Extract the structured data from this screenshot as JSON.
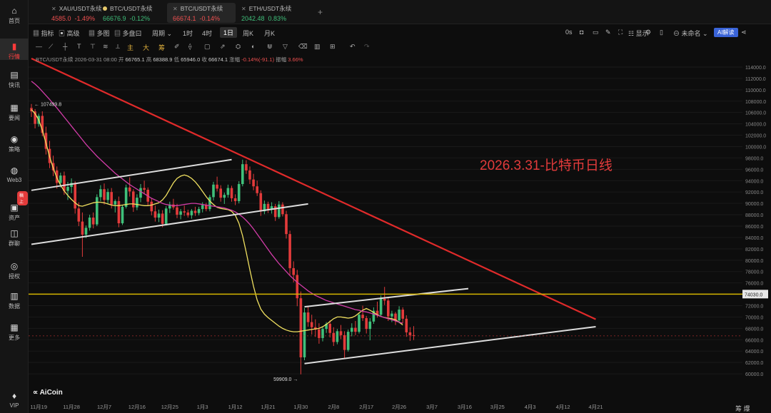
{
  "sidebar": {
    "items": [
      {
        "label": "首页",
        "icon": "home-icon",
        "glyph": "⌂"
      },
      {
        "label": "行情",
        "icon": "market-icon",
        "glyph": "▮"
      },
      {
        "label": "快讯",
        "icon": "news-icon",
        "glyph": "▤"
      },
      {
        "label": "要闻",
        "icon": "headline-icon",
        "glyph": "▦"
      },
      {
        "label": "策略",
        "icon": "strategy-icon",
        "glyph": "◉"
      },
      {
        "label": "Web3",
        "icon": "web3-icon",
        "glyph": "◍"
      },
      {
        "label": "资产",
        "icon": "asset-icon",
        "glyph": "▣"
      },
      {
        "label": "群聊",
        "icon": "chat-icon",
        "glyph": "◫"
      },
      {
        "label": "授权",
        "icon": "auth-icon",
        "glyph": "◎"
      },
      {
        "label": "数据",
        "icon": "data-icon",
        "glyph": "▥"
      },
      {
        "label": "更多",
        "icon": "more-icon",
        "glyph": "▦"
      },
      {
        "label": "VIP",
        "icon": "vip-icon",
        "glyph": "♦"
      }
    ],
    "badge": "稿上"
  },
  "tabs": [
    {
      "name": "XAU/USDT永续",
      "price": "4585.0",
      "change": "-1.49%",
      "dir": "down",
      "marker": "close"
    },
    {
      "name": "BTC/USDT永续",
      "price": "66676.9",
      "change": "-0.12%",
      "dir": "up",
      "marker": "dot"
    },
    {
      "name": "BTC/USDT永续",
      "price": "66674.1",
      "change": "-0.14%",
      "dir": "down",
      "marker": "close"
    },
    {
      "name": "ETH/USDT永续",
      "price": "2042.48",
      "change": "0.83%",
      "dir": "up",
      "marker": "close"
    }
  ],
  "add_tab": "+",
  "toolbar": {
    "indicator": "指标",
    "advanced": "高级",
    "multi": "多图",
    "multi_panel": "多盘口",
    "period": "周期",
    "p1h": "1时",
    "p4h": "4时",
    "p1d": "1日",
    "p1w": "周K",
    "p1m": "月K",
    "seconds": "0s",
    "display": "显示",
    "unnamed": "未命名",
    "ai": "AI解读"
  },
  "drawbar": {
    "main": "主",
    "big": "大",
    "chip": "筹"
  },
  "info": {
    "symbol": "BTC/USDT永续",
    "time": "2026-03-31 08:00",
    "open_label": "开",
    "open": "66765.1",
    "high_label": "高",
    "high": "68388.9",
    "low_label": "低",
    "low": "65946.0",
    "close_label": "收",
    "close": "66674.1",
    "chg_label": "涨幅",
    "chg": "-0.14%(-91.1)",
    "amp_label": "振幅",
    "amp": "3.66%"
  },
  "logo": "AiCoin",
  "bottom_right": "筹 爆",
  "chart_data": {
    "type": "candlestick",
    "title": "2026.3.31-比特币日线",
    "title_color": "#e23b3b",
    "up_color": "#3fbf7a",
    "down_color": "#e23b3b",
    "ylim": [
      58000,
      115000
    ],
    "y_ticks": [
      60000,
      62000,
      64000,
      66000,
      68000,
      70000,
      72000,
      74000,
      76000,
      78000,
      80000,
      82000,
      84000,
      86000,
      88000,
      90000,
      92000,
      94000,
      96000,
      98000,
      100000,
      102000,
      104000,
      106000,
      108000,
      110000,
      112000,
      114000
    ],
    "x_ticks": [
      "11月19",
      "11月28",
      "12月7",
      "12月16",
      "12月25",
      "1月3",
      "1月12",
      "1月21",
      "1月30",
      "2月8",
      "2月17",
      "2月26",
      "3月7",
      "3月16",
      "3月25",
      "4月3",
      "4月12",
      "4月21"
    ],
    "annotations": [
      {
        "label": "107499.8",
        "price": 107499.8,
        "kind": "high"
      },
      {
        "label": "59909.0",
        "price": 59909.0,
        "kind": "low"
      }
    ],
    "horizontal_level": {
      "price": 74030.0,
      "label": "74030.0",
      "color": "#d4b400"
    },
    "current_price": {
      "price": 66674.1,
      "color": "#e23b3b"
    },
    "series": [
      {
        "name": "MA-short",
        "color": "#f0e060",
        "values": [
          106500,
          105800,
          104700,
          102900,
          100600,
          98200,
          96200,
          94500,
          93200,
          92200,
          91400,
          90700,
          90100,
          89600,
          89500,
          89700,
          89900,
          90100,
          90200,
          90200,
          90100,
          89900,
          89700,
          89600,
          89600,
          89700,
          89800,
          89900,
          89900,
          89800,
          89700,
          89600,
          89600,
          89700,
          89900,
          90100,
          90600,
          91400,
          92500,
          93600,
          94400,
          94800,
          95000,
          94800,
          94400,
          93800,
          93000,
          92100,
          91200,
          90400,
          89800,
          89300,
          89100,
          89000,
          88900,
          88600,
          87900,
          86500,
          84300,
          81400,
          78300,
          75400,
          73000,
          71400,
          70500,
          69900,
          69400,
          68900,
          68400,
          68000,
          67700,
          67500,
          67400,
          67400,
          67500,
          67600,
          67700,
          67800,
          67900,
          68000,
          68300,
          68700,
          69200,
          69700,
          70000,
          70000,
          69900,
          69800,
          69900,
          70200,
          70700,
          71200,
          71500,
          71200,
          70800,
          70400,
          70100,
          69900,
          69800,
          69700,
          69500,
          69100,
          68600
        ]
      },
      {
        "name": "MA-long",
        "color": "#d23ca8",
        "values": [
          111500,
          111000,
          110400,
          109700,
          109000,
          108300,
          107500,
          106800,
          106000,
          105200,
          104400,
          103600,
          102800,
          102000,
          101200,
          100400,
          99700,
          99000,
          98300,
          97700,
          97100,
          96500,
          95900,
          95300,
          94800,
          94300,
          93800,
          93300,
          92900,
          92500,
          92100,
          91700,
          91300,
          90900,
          90600,
          90300,
          90000,
          89800,
          89700,
          89600,
          89600,
          89700,
          89800,
          89900,
          90000,
          90000,
          89900,
          89800,
          89700,
          89600,
          89500,
          89400,
          89300,
          89200,
          89000,
          88800,
          88500,
          88100,
          87600,
          87000,
          86300,
          85500,
          84600,
          83700,
          82800,
          81900,
          81000,
          80200,
          79400,
          78700,
          78000,
          77300,
          76700,
          76100,
          75600,
          75100,
          74600,
          74200,
          73800,
          73500,
          73200,
          72900,
          72700,
          72500,
          72300,
          72100,
          71900,
          71700,
          71500,
          71300,
          71200,
          71000,
          70900,
          70700,
          70500,
          70300,
          70100,
          69900,
          69700,
          69500,
          69300,
          69100,
          68900
        ]
      }
    ],
    "trendlines": [
      {
        "name": "downtrend",
        "color": "#e02a2a",
        "from": {
          "x": "11月17",
          "y": 115500
        },
        "to": {
          "x": "4月21",
          "y": 69600
        }
      },
      {
        "name": "channel-upper-1",
        "color": "#dddddd",
        "from": {
          "x": "11月17",
          "y": 92300
        },
        "to": {
          "x": "1月11",
          "y": 97700
        }
      },
      {
        "name": "channel-lower-1",
        "color": "#dddddd",
        "from": {
          "x": "11月17",
          "y": 82800
        },
        "to": {
          "x": "2月1",
          "y": 89900
        }
      },
      {
        "name": "channel-upper-2",
        "color": "#dddddd",
        "from": {
          "x": "1月31",
          "y": 71800
        },
        "to": {
          "x": "3月17",
          "y": 75000
        }
      },
      {
        "name": "channel-lower-2",
        "color": "#dddddd",
        "from": {
          "x": "1月31",
          "y": 61800
        },
        "to": {
          "x": "4月21",
          "y": 68300
        }
      }
    ],
    "candles": [
      [
        106800,
        107499.8,
        105200,
        106200
      ],
      [
        106200,
        106600,
        103200,
        104000
      ],
      [
        104000,
        105800,
        103500,
        105400
      ],
      [
        105400,
        106200,
        101800,
        102400
      ],
      [
        102400,
        103500,
        98600,
        99600
      ],
      [
        99600,
        101000,
        96200,
        97100
      ],
      [
        97100,
        98400,
        94800,
        95800
      ],
      [
        95800,
        96500,
        92600,
        93600
      ],
      [
        93600,
        95400,
        92800,
        94900
      ],
      [
        94900,
        95600,
        91500,
        92200
      ],
      [
        92200,
        93800,
        90600,
        92900
      ],
      [
        92900,
        94400,
        91800,
        93600
      ],
      [
        93600,
        93900,
        88200,
        89100
      ],
      [
        89100,
        90200,
        86000,
        86800
      ],
      [
        86800,
        88400,
        80600,
        84500
      ],
      [
        84500,
        86100,
        83900,
        85700
      ],
      [
        85700,
        88000,
        85200,
        87500
      ],
      [
        87500,
        88400,
        85600,
        86300
      ],
      [
        86300,
        91600,
        86000,
        91100
      ],
      [
        91100,
        93200,
        90400,
        92500
      ],
      [
        92500,
        93500,
        89800,
        90600
      ],
      [
        90600,
        92600,
        90000,
        92000
      ],
      [
        92000,
        92700,
        89100,
        89800
      ],
      [
        89800,
        90700,
        88400,
        90400
      ],
      [
        90400,
        91200,
        85800,
        86500
      ],
      [
        86500,
        89700,
        86200,
        89400
      ],
      [
        89400,
        93300,
        89100,
        92800
      ],
      [
        92800,
        94600,
        91200,
        92100
      ],
      [
        92100,
        92500,
        88500,
        89300
      ],
      [
        89300,
        91600,
        88800,
        91000
      ],
      [
        91000,
        93400,
        90200,
        92700
      ],
      [
        92700,
        94000,
        91600,
        92400
      ],
      [
        92400,
        92800,
        89600,
        90300
      ],
      [
        90300,
        90900,
        87900,
        88600
      ],
      [
        88600,
        89600,
        86800,
        87500
      ],
      [
        87500,
        88900,
        86700,
        88200
      ],
      [
        88200,
        88800,
        85800,
        86400
      ],
      [
        86400,
        89500,
        86100,
        89100
      ],
      [
        89100,
        90300,
        88300,
        89800
      ],
      [
        89800,
        90800,
        88900,
        89300
      ],
      [
        89300,
        89900,
        87400,
        88000
      ],
      [
        88000,
        89000,
        87200,
        88600
      ],
      [
        88600,
        89600,
        87800,
        88400
      ],
      [
        88400,
        88900,
        87500,
        87900
      ],
      [
        87900,
        89000,
        87300,
        88700
      ],
      [
        88700,
        89400,
        87800,
        88300
      ],
      [
        88300,
        89400,
        87900,
        89000
      ],
      [
        89000,
        90200,
        88400,
        89700
      ],
      [
        89700,
        90100,
        88600,
        89000
      ],
      [
        89000,
        91500,
        88600,
        91100
      ],
      [
        91100,
        93800,
        90500,
        93300
      ],
      [
        93300,
        94700,
        92100,
        92600
      ],
      [
        92600,
        93200,
        90300,
        91000
      ],
      [
        91000,
        91900,
        89900,
        91500
      ],
      [
        91500,
        93300,
        91000,
        92700
      ],
      [
        92700,
        93100,
        90300,
        90900
      ],
      [
        90900,
        91600,
        89700,
        90400
      ],
      [
        90400,
        93900,
        90000,
        93400
      ],
      [
        93400,
        97700,
        93000,
        96900
      ],
      [
        96900,
        97600,
        95200,
        95800
      ],
      [
        95800,
        96500,
        93400,
        94200
      ],
      [
        94200,
        95200,
        92300,
        93000
      ],
      [
        93000,
        94000,
        91300,
        91800
      ],
      [
        91800,
        92300,
        87800,
        88600
      ],
      [
        88600,
        90500,
        88100,
        89900
      ],
      [
        89900,
        90300,
        88300,
        89000
      ],
      [
        89000,
        90200,
        88200,
        89500
      ],
      [
        89500,
        89900,
        86900,
        87600
      ],
      [
        87600,
        90400,
        87300,
        89800
      ],
      [
        89800,
        90200,
        87700,
        88100
      ],
      [
        88100,
        88700,
        83800,
        84600
      ],
      [
        84600,
        85200,
        77400,
        78600
      ],
      [
        78600,
        79800,
        76100,
        77400
      ],
      [
        77400,
        78300,
        71900,
        73300
      ],
      [
        73300,
        74500,
        59909.0,
        62900
      ],
      [
        62900,
        71600,
        62400,
        70800
      ],
      [
        70800,
        71900,
        68300,
        69100
      ],
      [
        69100,
        70400,
        66900,
        68200
      ],
      [
        68200,
        69600,
        66500,
        67800
      ],
      [
        67800,
        68900,
        65300,
        66300
      ],
      [
        66300,
        68300,
        65700,
        67900
      ],
      [
        67900,
        69100,
        67200,
        68800
      ],
      [
        68800,
        69400,
        66400,
        67200
      ],
      [
        67200,
        68200,
        64900,
        65600
      ],
      [
        65600,
        67900,
        65200,
        67500
      ],
      [
        67500,
        68600,
        66100,
        66800
      ],
      [
        66800,
        67500,
        62800,
        64200
      ],
      [
        64200,
        67800,
        63900,
        67400
      ],
      [
        67400,
        68900,
        66600,
        68100
      ],
      [
        68100,
        69300,
        66800,
        67400
      ],
      [
        67400,
        70800,
        67100,
        70400
      ],
      [
        70400,
        72000,
        69300,
        69800
      ],
      [
        69800,
        70200,
        67100,
        67900
      ],
      [
        67900,
        69800,
        65900,
        69200
      ],
      [
        69200,
        71700,
        68800,
        71100
      ],
      [
        71100,
        72700,
        69900,
        70400
      ],
      [
        70400,
        73800,
        70100,
        73200
      ],
      [
        73200,
        75300,
        72100,
        72900
      ],
      [
        72900,
        73400,
        69300,
        70100
      ],
      [
        70100,
        71100,
        69100,
        70600
      ],
      [
        70600,
        70900,
        68600,
        69400
      ],
      [
        69400,
        71900,
        68900,
        71300
      ],
      [
        71300,
        71700,
        68900,
        69700
      ],
      [
        69700,
        70300,
        66500,
        67300
      ],
      [
        67300,
        68200,
        65800,
        66800
      ],
      [
        66800,
        68388.9,
        65946.0,
        66674.1
      ]
    ]
  }
}
